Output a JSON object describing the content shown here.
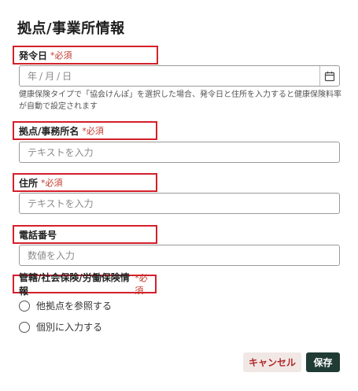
{
  "page": {
    "title": "拠点/事業所情報"
  },
  "required_mark": "*必須",
  "fields": {
    "issue_date": {
      "label": "発令日",
      "date_y": "年",
      "date_m": "月",
      "date_d": "日",
      "sep": "/",
      "help": "健康保険タイプで「協会けんぽ」を選択した場合、発令日と住所を入力すると健康保険料率が自動で設定されます"
    },
    "office_name": {
      "label": "拠点/事務所名",
      "placeholder": "テキストを入力"
    },
    "address": {
      "label": "住所",
      "placeholder": "テキストを入力"
    },
    "phone": {
      "label": "電話番号",
      "placeholder": "数値を入力"
    },
    "insurance": {
      "label": "管轄/社会保険/労働保険情報",
      "options": [
        "他拠点を参照する",
        "個別に入力する"
      ]
    }
  },
  "buttons": {
    "cancel": "キャンセル",
    "save": "保存"
  },
  "icons": {
    "calendar": "calendar-icon"
  },
  "colors": {
    "highlight": "#d4202a",
    "required": "#c0392b",
    "save_bg": "#1f3b34",
    "cancel_bg": "#f1e8e6"
  }
}
